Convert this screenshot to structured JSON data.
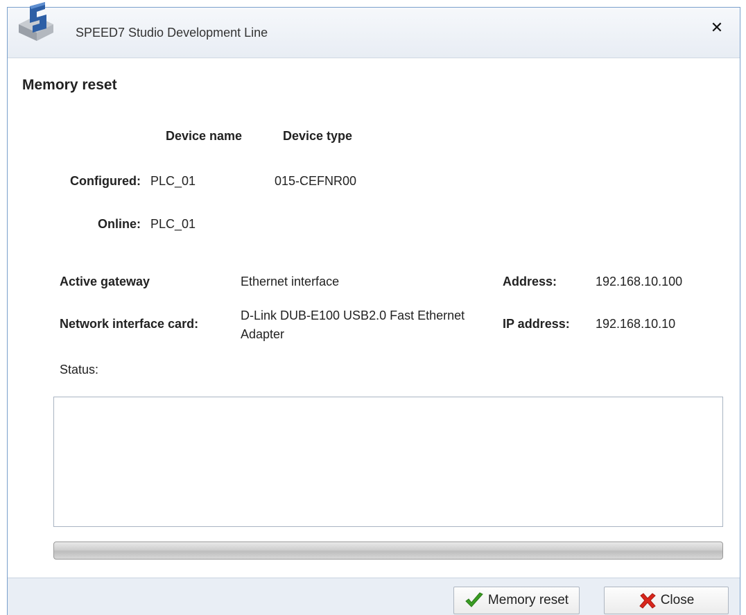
{
  "window": {
    "title": "SPEED7 Studio Development Line",
    "close_glyph": "✕",
    "close_icon": "close-icon",
    "logo_icon": "speed7-logo-icon"
  },
  "dialog": {
    "heading": "Memory reset",
    "columns": {
      "device_name": "Device name",
      "device_type": "Device type"
    },
    "configured": {
      "label": "Configured:",
      "device_name": "PLC_01",
      "device_type": "015-CEFNR00"
    },
    "online": {
      "label": "Online:",
      "device_name": "PLC_01"
    },
    "gateway": {
      "label": "Active gateway",
      "value": "Ethernet interface",
      "address_label": "Address:",
      "address_value": "192.168.10.100"
    },
    "nic": {
      "label": "Network interface card:",
      "value_line1": "D-Link DUB-E100 USB2.0 Fast Ethernet",
      "value_line2": "Adapter",
      "ip_label": "IP address:",
      "ip_value": "192.168.10.10"
    },
    "status": {
      "label": "Status:",
      "text": ""
    },
    "progress": {
      "value": 0
    }
  },
  "footer": {
    "memory_reset_label": "Memory reset",
    "memory_reset_icon": "checkmark-icon",
    "close_label": "Close",
    "close_icon": "red-x-icon"
  },
  "colors": {
    "window_border": "#7aa0cc",
    "footer_bg": "#e9eef5",
    "check_green": "#3a9d23",
    "close_red": "#d9261c"
  }
}
